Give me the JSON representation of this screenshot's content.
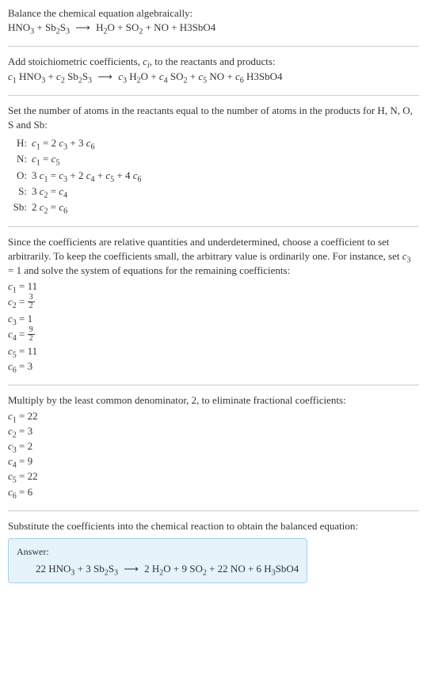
{
  "s1": {
    "line1": "Balance the chemical equation algebraically:",
    "line2": "HNO₃ + Sb₂S₃  ⟶  H₂O + SO₂ + NO + H3SbO4"
  },
  "s2": {
    "line1_pre": "Add stoichiometric coefficients, ",
    "line1_ci": "c",
    "line1_i": "i",
    "line1_post": ", to the reactants and products:",
    "line2": "c₁ HNO₃ + c₂ Sb₂S₃  ⟶  c₃ H₂O + c₄ SO₂ + c₅ NO + c₆ H3SbO4"
  },
  "s3": {
    "intro": "Set the number of atoms in the reactants equal to the number of atoms in the products for H, N, O, S and Sb:",
    "rows": [
      {
        "el": "H:",
        "eq": "c₁ = 2 c₃ + 3 c₆"
      },
      {
        "el": "N:",
        "eq": "c₁ = c₅"
      },
      {
        "el": "O:",
        "eq": "3 c₁ = c₃ + 2 c₄ + c₅ + 4 c₆"
      },
      {
        "el": "S:",
        "eq": "3 c₂ = c₄"
      },
      {
        "el": "Sb:",
        "eq": "2 c₂ = c₆"
      }
    ]
  },
  "s4": {
    "intro": "Since the coefficients are relative quantities and underdetermined, choose a coefficient to set arbitrarily. To keep the coefficients small, the arbitrary value is ordinarily one. For instance, set c₃ = 1 and solve the system of equations for the remaining coefficients:",
    "c1": "c₁ = 11",
    "c2_pre": "c₂ = ",
    "c2_num": "3",
    "c2_den": "2",
    "c3": "c₃ = 1",
    "c4_pre": "c₄ = ",
    "c4_num": "9",
    "c4_den": "2",
    "c5": "c₅ = 11",
    "c6": "c₆ = 3"
  },
  "s5": {
    "intro": "Multiply by the least common denominator, 2, to eliminate fractional coefficients:",
    "lines": [
      "c₁ = 22",
      "c₂ = 3",
      "c₃ = 2",
      "c₄ = 9",
      "c₅ = 22",
      "c₆ = 6"
    ]
  },
  "s6": {
    "intro": "Substitute the coefficients into the chemical reaction to obtain the balanced equation:",
    "answer_label": "Answer:",
    "answer": "22 HNO₃ + 3 Sb₂S₃  ⟶  2 H₂O + 9 SO₂ + 22 NO + 6 H₃SbO4"
  }
}
